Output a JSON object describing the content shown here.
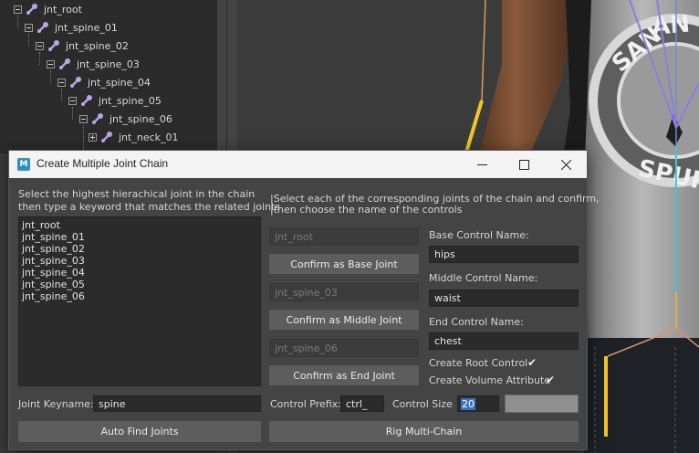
{
  "outliner": {
    "items": [
      {
        "label": "jnt_root"
      },
      {
        "label": "jnt_spine_01"
      },
      {
        "label": "jnt_spine_02"
      },
      {
        "label": "jnt_spine_03"
      },
      {
        "label": "jnt_spine_04"
      },
      {
        "label": "jnt_spine_05"
      },
      {
        "label": "jnt_spine_06"
      },
      {
        "label": "jnt_neck_01"
      }
    ]
  },
  "dialog": {
    "title": "Create Multiple Joint Chain",
    "left_instructions": [
      "Select the highest hierachical joint in the chain",
      "then type a keyword that matches the related joints"
    ],
    "right_instructions": [
      "|Select each of the corresponding joints of the chain and confirm,",
      "|then choose the name of the controls"
    ],
    "joint_list": [
      "jnt_root",
      "jnt_spine_01",
      "jnt_spine_02",
      "jnt_spine_03",
      "jnt_spine_04",
      "jnt_spine_05",
      "jnt_spine_06"
    ],
    "base_joint_field": "jnt_root",
    "confirm_base_label": "Confirm as Base Joint",
    "middle_joint_field": "jnt_spine_03",
    "confirm_middle_label": "Confirm as Middle Joint",
    "end_joint_field": "jnt_spine_06",
    "confirm_end_label": "Confirm as End Joint",
    "base_control_label": "Base Control Name:",
    "base_control_value": "hips",
    "middle_control_label": "Middle Control Name:",
    "middle_control_value": "waist",
    "end_control_label": "End Control Name:",
    "end_control_value": "chest",
    "create_root_label": "Create Root Control",
    "create_root_checked": true,
    "create_volume_label": "Create Volume Attribute",
    "create_volume_checked": true,
    "keyname_label": "Joint Keyname:",
    "keyname_value": "spine",
    "prefix_label": "Control Prefix:",
    "prefix_value": "ctrl_",
    "size_label": "Control Size",
    "size_value": "20",
    "auto_find_label": "Auto Find Joints",
    "rig_label": "Rig Multi-Chain",
    "check_glyph": "✔"
  },
  "colors": {
    "dialog_bg": "#444444",
    "field_bg": "#2b2b2b",
    "button_bg": "#5d5d5d",
    "selection": "#3a73c2",
    "joint_icon": "#b7a7e8"
  }
}
